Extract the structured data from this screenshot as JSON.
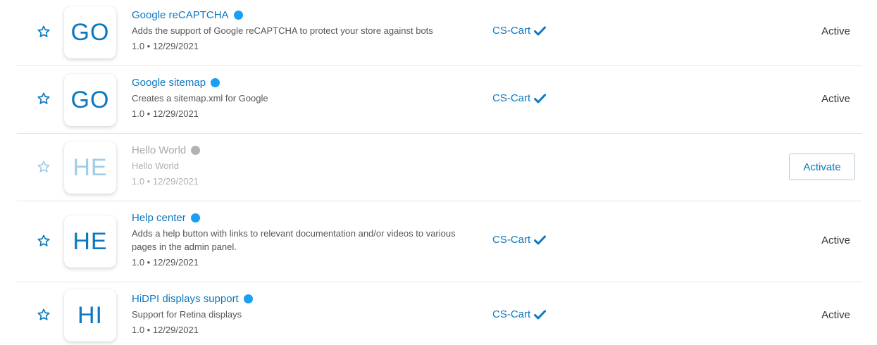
{
  "colors": {
    "accent": "#0b78bf",
    "active_dot": "#1aa0f2",
    "inactive_dot": "#b2b2b2",
    "divider": "#e4e4e4"
  },
  "addons": [
    {
      "icon_text": "GO",
      "title": "Google reCAPTCHA",
      "description": "Adds the support of Google reCAPTCHA to protect your store against bots",
      "meta": "1.0 • 12/29/2021",
      "developer": "CS-Cart",
      "developer_icon": "verified-check-icon",
      "status": "Active",
      "enabled": true
    },
    {
      "icon_text": "GO",
      "title": "Google sitemap",
      "description": "Creates a sitemap.xml for Google",
      "meta": "1.0 • 12/29/2021",
      "developer": "CS-Cart",
      "developer_icon": "verified-check-icon",
      "status": "Active",
      "enabled": true
    },
    {
      "icon_text": "HE",
      "title": "Hello World",
      "description": "Hello World",
      "meta": "1.0 • 12/29/2021",
      "developer": "",
      "status": "",
      "action_label": "Activate",
      "enabled": false
    },
    {
      "icon_text": "HE",
      "title": "Help center",
      "description": "Adds a help button with links to relevant documentation and/or videos to various pages in the admin panel.",
      "meta": "1.0 • 12/29/2021",
      "developer": "CS-Cart",
      "developer_icon": "verified-check-icon",
      "status": "Active",
      "enabled": true
    },
    {
      "icon_text": "HI",
      "title": "HiDPI displays support",
      "description": "Support for Retina displays",
      "meta": "1.0 • 12/29/2021",
      "developer": "CS-Cart",
      "developer_icon": "verified-check-icon",
      "status": "Active",
      "enabled": true
    }
  ]
}
